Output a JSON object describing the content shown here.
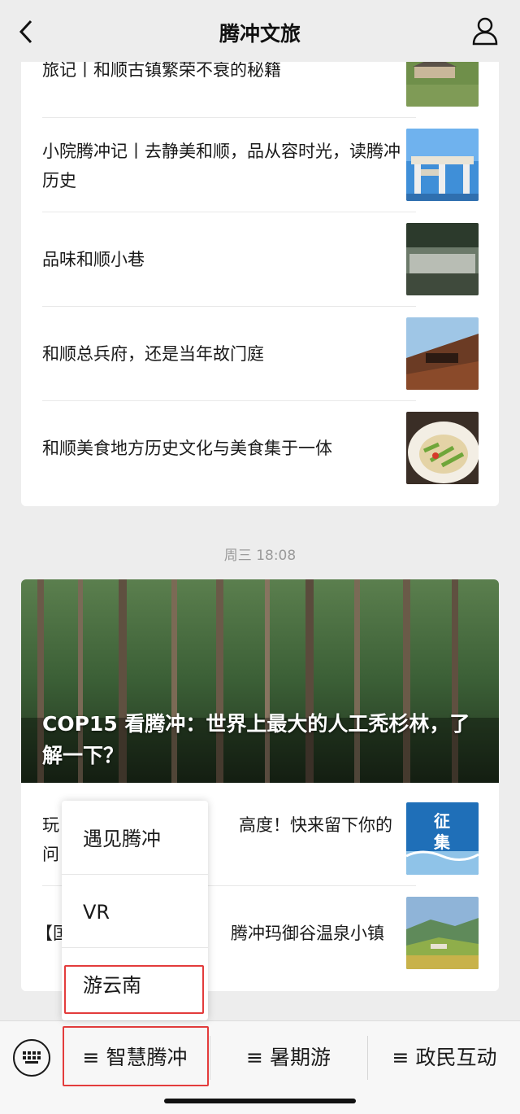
{
  "header": {
    "title": "腾冲文旅",
    "back_icon": "chevron-left-icon",
    "profile_icon": "user-icon"
  },
  "articles_top": [
    {
      "title": "旅记丨和顺古镇繁荣不衰的秘籍"
    },
    {
      "title": "小院腾冲记丨去静美和顺，品从容时光，读腾冲历史"
    },
    {
      "title": "品味和顺小巷"
    },
    {
      "title": "和顺总兵府，还是当年故门庭"
    },
    {
      "title": "和顺美食地方历史文化与美食集于一体"
    }
  ],
  "timestamp": "周三 18:08",
  "featured": {
    "title": "COP15 看腾冲：世界上最大的人工秃杉林，了解一下？"
  },
  "articles_bottom": [
    {
      "title_left": "玩",
      "title_left2": "问",
      "title_right": "高度！快来留下你的",
      "thumb_text": "征集"
    },
    {
      "title_left": "【国",
      "title_right": "腾冲玛御谷温泉小镇"
    }
  ],
  "popup_menu": {
    "items": [
      "遇见腾冲",
      "VR",
      "游云南"
    ],
    "highlighted": "游云南"
  },
  "bottom_menu": {
    "keyboard_icon": "keyboard-icon",
    "items": [
      {
        "label": "≡ 智慧腾冲"
      },
      {
        "label": "≡ 暑期游"
      },
      {
        "label": "≡ 政民互动"
      }
    ]
  },
  "colors": {
    "highlight": "#e33c3c",
    "background": "#ededed"
  }
}
